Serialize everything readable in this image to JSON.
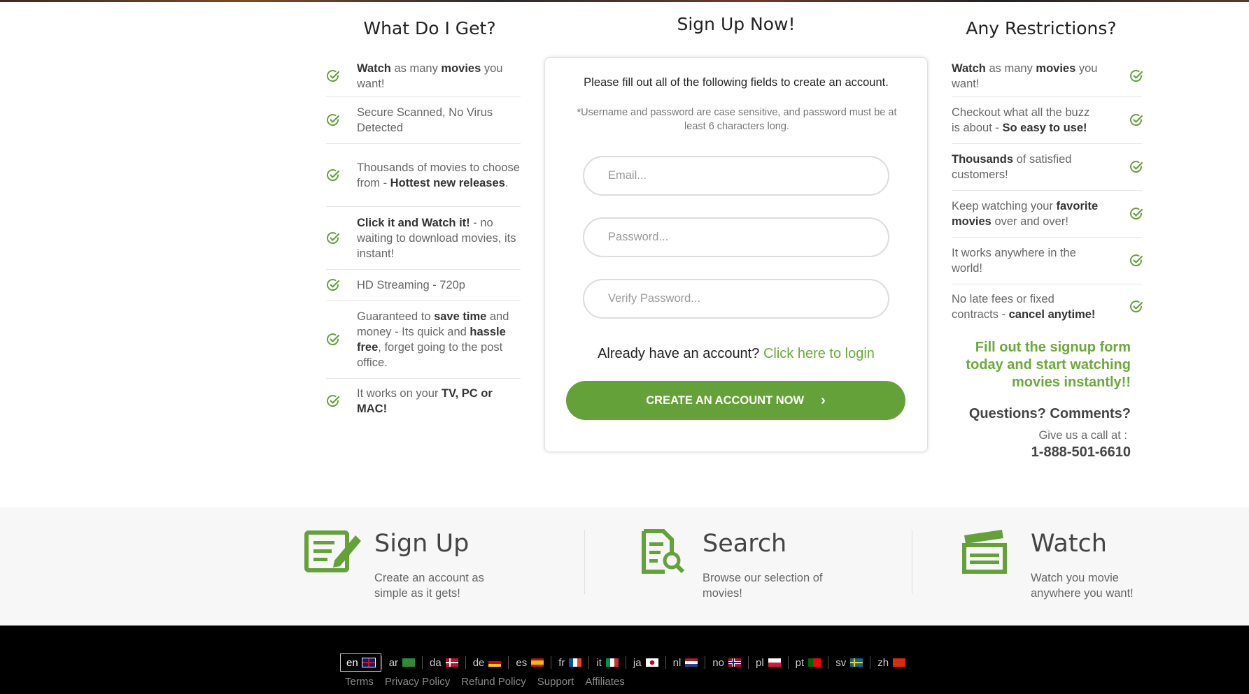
{
  "left": {
    "title": "What Do I Get?",
    "features": [
      {
        "parts": [
          {
            "t": "Watch",
            "b": true
          },
          {
            "t": " as many ",
            "b": false
          },
          {
            "t": "movies",
            "b": true
          },
          {
            "t": " you want!",
            "b": false
          }
        ]
      },
      {
        "parts": [
          {
            "t": "Secure Scanned, No Virus Detected",
            "b": false
          }
        ]
      },
      {
        "parts": [
          {
            "t": "Thousands of movies to choose from - ",
            "b": false
          },
          {
            "t": "Hottest new releases",
            "b": true
          },
          {
            "t": ".",
            "b": false
          }
        ]
      },
      {
        "parts": [
          {
            "t": "Click it and Watch it!",
            "b": true
          },
          {
            "t": " - no waiting to download movies, its instant!",
            "b": false
          }
        ]
      },
      {
        "parts": [
          {
            "t": "HD Streaming - 720p",
            "b": false
          }
        ]
      },
      {
        "parts": [
          {
            "t": "Guaranteed to ",
            "b": false
          },
          {
            "t": "save time",
            "b": true
          },
          {
            "t": " and money - Its quick and ",
            "b": false
          },
          {
            "t": "hassle free",
            "b": true
          },
          {
            "t": ", forget going to the post office.",
            "b": false
          }
        ]
      },
      {
        "parts": [
          {
            "t": "It works on your ",
            "b": false
          },
          {
            "t": "TV, PC or MAC!",
            "b": true
          }
        ]
      }
    ]
  },
  "form": {
    "title": "Sign Up Now!",
    "intro": "Please fill out all of the following fields to create an account.",
    "note": "*Username and password are case sensitive, and password must be at least 6 characters long.",
    "email_placeholder": "Email...",
    "password_placeholder": "Password...",
    "verify_placeholder": "Verify Password...",
    "already_text": "Already have an account?",
    "login_link": "Click here to login",
    "cta_label": "CREATE AN ACCOUNT NOW"
  },
  "right": {
    "title": "Any Restrictions?",
    "features": [
      {
        "parts": [
          {
            "t": "Watch",
            "b": true
          },
          {
            "t": " as many ",
            "b": false
          },
          {
            "t": "movies",
            "b": true
          },
          {
            "t": " you want!",
            "b": false
          }
        ]
      },
      {
        "parts": [
          {
            "t": "Checkout what all the buzz is about - ",
            "b": false
          },
          {
            "t": "So easy to use!",
            "b": true
          }
        ]
      },
      {
        "parts": [
          {
            "t": "Thousands",
            "b": true
          },
          {
            "t": " of satisfied customers!",
            "b": false
          }
        ]
      },
      {
        "parts": [
          {
            "t": "Keep watching your ",
            "b": false
          },
          {
            "t": "favorite movies",
            "b": true
          },
          {
            "t": " over and over!",
            "b": false
          }
        ]
      },
      {
        "parts": [
          {
            "t": "It works anywhere in the world!",
            "b": false
          }
        ]
      },
      {
        "parts": [
          {
            "t": "No late fees or fixed contracts - ",
            "b": false
          },
          {
            "t": "cancel anytime!",
            "b": true
          }
        ]
      }
    ],
    "promo": "Fill out the signup form today and start watching movies instantly!!",
    "questions": "Questions? Comments?",
    "call_text": "Give us a call at :",
    "phone": "1-888-501-6610"
  },
  "steps": [
    {
      "icon": "signup-form-icon",
      "title": "Sign Up",
      "desc": "Create an account as simple as it gets!"
    },
    {
      "icon": "search-document-icon",
      "title": "Search",
      "desc": "Browse our selection of movies!"
    },
    {
      "icon": "clapperboard-icon",
      "title": "Watch",
      "desc": "Watch you movie anywhere you want!"
    }
  ],
  "footer": {
    "languages": [
      {
        "code": "en",
        "active": true
      },
      {
        "code": "ar",
        "active": false
      },
      {
        "code": "da",
        "active": false
      },
      {
        "code": "de",
        "active": false
      },
      {
        "code": "es",
        "active": false
      },
      {
        "code": "fr",
        "active": false
      },
      {
        "code": "it",
        "active": false
      },
      {
        "code": "ja",
        "active": false
      },
      {
        "code": "nl",
        "active": false
      },
      {
        "code": "no",
        "active": false
      },
      {
        "code": "pl",
        "active": false
      },
      {
        "code": "pt",
        "active": false
      },
      {
        "code": "sv",
        "active": false
      },
      {
        "code": "zh",
        "active": false
      }
    ],
    "links": [
      "Terms",
      "Privacy Policy",
      "Refund Policy",
      "Support",
      "Affiliates"
    ]
  },
  "colors": {
    "accent": "#64a239",
    "link": "#6aaa3a",
    "footer_bg": "#000000",
    "band_bg": "#f7f7f7"
  }
}
